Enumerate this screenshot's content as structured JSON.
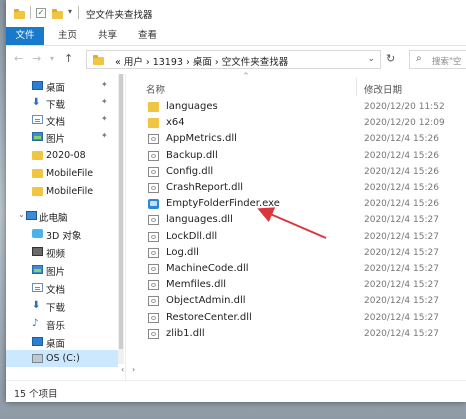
{
  "window": {
    "title": "空文件夹查找器"
  },
  "ribbon": {
    "tabs": [
      "文件",
      "主页",
      "共享",
      "查看"
    ]
  },
  "address": {
    "breadcrumb": [
      "用户",
      "13193",
      "桌面",
      "空文件夹查找器"
    ],
    "leading": "«",
    "search_placeholder": "搜索\"空"
  },
  "sidebar": {
    "items": [
      {
        "label": "桌面",
        "icon": "desktop-icon",
        "pinned": true
      },
      {
        "label": "下载",
        "icon": "download-icon",
        "pinned": true
      },
      {
        "label": "文档",
        "icon": "documents-icon",
        "pinned": true
      },
      {
        "label": "图片",
        "icon": "pictures-icon",
        "pinned": true
      },
      {
        "label": "2020-08",
        "icon": "folder-icon",
        "pinned": false
      },
      {
        "label": "MobileFile",
        "icon": "folder-icon",
        "pinned": false
      },
      {
        "label": "MobileFile",
        "icon": "folder-icon",
        "pinned": false
      },
      {
        "label": "此电脑",
        "icon": "computer-icon",
        "pinned": false
      },
      {
        "label": "3D 对象",
        "icon": "3d-objects-icon",
        "pinned": false
      },
      {
        "label": "视频",
        "icon": "videos-icon",
        "pinned": false
      },
      {
        "label": "图片",
        "icon": "pictures-icon",
        "pinned": false
      },
      {
        "label": "文档",
        "icon": "documents-icon",
        "pinned": false
      },
      {
        "label": "下载",
        "icon": "download-icon",
        "pinned": false
      },
      {
        "label": "音乐",
        "icon": "music-icon",
        "pinned": false
      },
      {
        "label": "桌面",
        "icon": "desktop-icon",
        "pinned": false
      },
      {
        "label": "OS (C:)",
        "icon": "drive-icon",
        "pinned": false
      }
    ]
  },
  "columns": {
    "name": "名称",
    "date": "修改日期"
  },
  "files": [
    {
      "name": "languages",
      "date": "2020/12/20 11:52",
      "type": "folder"
    },
    {
      "name": "x64",
      "date": "2020/12/20 12:09",
      "type": "folder"
    },
    {
      "name": "AppMetrics.dll",
      "date": "2020/12/4 15:26",
      "type": "dll"
    },
    {
      "name": "Backup.dll",
      "date": "2020/12/4 15:26",
      "type": "dll"
    },
    {
      "name": "Config.dll",
      "date": "2020/12/4 15:26",
      "type": "dll"
    },
    {
      "name": "CrashReport.dll",
      "date": "2020/12/4 15:26",
      "type": "dll"
    },
    {
      "name": "EmptyFolderFinder.exe",
      "date": "2020/12/4 15:26",
      "type": "exe"
    },
    {
      "name": "languages.dll",
      "date": "2020/12/4 15:27",
      "type": "dll"
    },
    {
      "name": "LockDll.dll",
      "date": "2020/12/4 15:27",
      "type": "dll"
    },
    {
      "name": "Log.dll",
      "date": "2020/12/4 15:27",
      "type": "dll"
    },
    {
      "name": "MachineCode.dll",
      "date": "2020/12/4 15:27",
      "type": "dll"
    },
    {
      "name": "Memfiles.dll",
      "date": "2020/12/4 15:27",
      "type": "dll"
    },
    {
      "name": "ObjectAdmin.dll",
      "date": "2020/12/4 15:27",
      "type": "dll"
    },
    {
      "name": "RestoreCenter.dll",
      "date": "2020/12/4 15:27",
      "type": "dll"
    },
    {
      "name": "zlib1.dll",
      "date": "2020/12/4 15:27",
      "type": "dll"
    }
  ],
  "status": {
    "count_text": "15 个项目"
  },
  "colors": {
    "accent": "#1979ca",
    "selection": "#cce8ff",
    "folder": "#f0c542",
    "arrow": "#d9363e"
  }
}
